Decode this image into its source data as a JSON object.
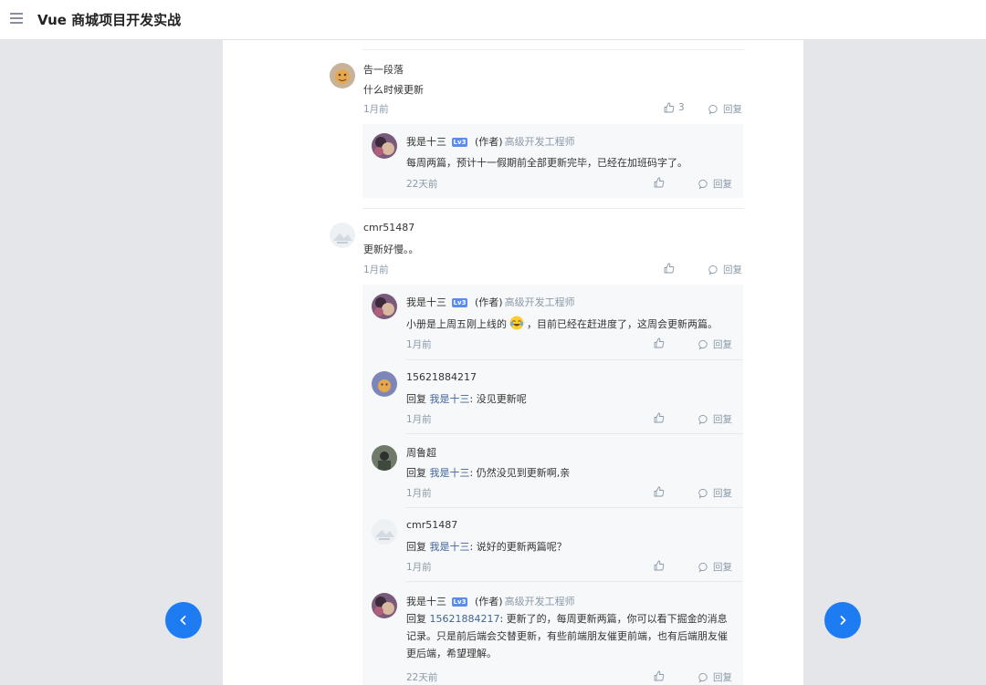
{
  "app": {
    "title": "Vue 商城项目开发实战"
  },
  "comments": [
    {
      "user": "告一段落",
      "text": "什么时候更新",
      "time": "1月前",
      "likes": "3",
      "reply_label": "回复",
      "replies": [
        {
          "user": "我是十三",
          "badge": "Lv3",
          "author_tag": "(作者)",
          "job": "高级开发工程师",
          "text": "每周两篇，预计十一假期前全部更新完毕，已经在加班码字了。",
          "time": "22天前",
          "reply_label": "回复"
        }
      ]
    },
    {
      "user": "cmr51487",
      "text": "更新好慢。。",
      "time": "1月前",
      "reply_label": "回复",
      "replies": [
        {
          "user": "我是十三",
          "badge": "Lv3",
          "author_tag": "(作者)",
          "job": "高级开发工程师",
          "text_before": "小册是上周五刚上线的",
          "emoji": "laughing-tears-emoji",
          "text_after": "，目前已经在赶进度了，这周会更新两篇。",
          "time": "1月前",
          "reply_label": "回复"
        },
        {
          "user": "15621884217",
          "reply_prefix": "回复",
          "mention": "我是十三",
          "text": ": 没见更新呢",
          "time": "1月前",
          "reply_label": "回复"
        },
        {
          "user": "周鲁超",
          "reply_prefix": "回复",
          "mention": "我是十三",
          "text": ": 仍然没见到更新啊,亲",
          "time": "1月前",
          "reply_label": "回复"
        },
        {
          "user": "cmr51487",
          "reply_prefix": "回复",
          "mention": "我是十三",
          "text": ": 说好的更新两篇呢？",
          "time": "1月前",
          "reply_label": "回复"
        },
        {
          "user": "我是十三",
          "badge": "Lv3",
          "author_tag": "(作者)",
          "job": "高级开发工程师",
          "reply_prefix": "回复",
          "mention": "15621884217",
          "text": ": 更新了的，每周更新两篇，你可以看下掘金的消息记录。只是前后端会交替更新，有些前端朋友催更前端，也有后端朋友催更后端，希望理解。",
          "time": "22天前",
          "reply_label": "回复"
        }
      ]
    }
  ],
  "nav": {
    "prev": "chevron-left-icon",
    "next": "chevron-right-icon"
  },
  "colors": {
    "accent": "#1d7cf2",
    "link": "#406599",
    "muted": "#8a9aa9",
    "badge": "#5b8de8"
  }
}
